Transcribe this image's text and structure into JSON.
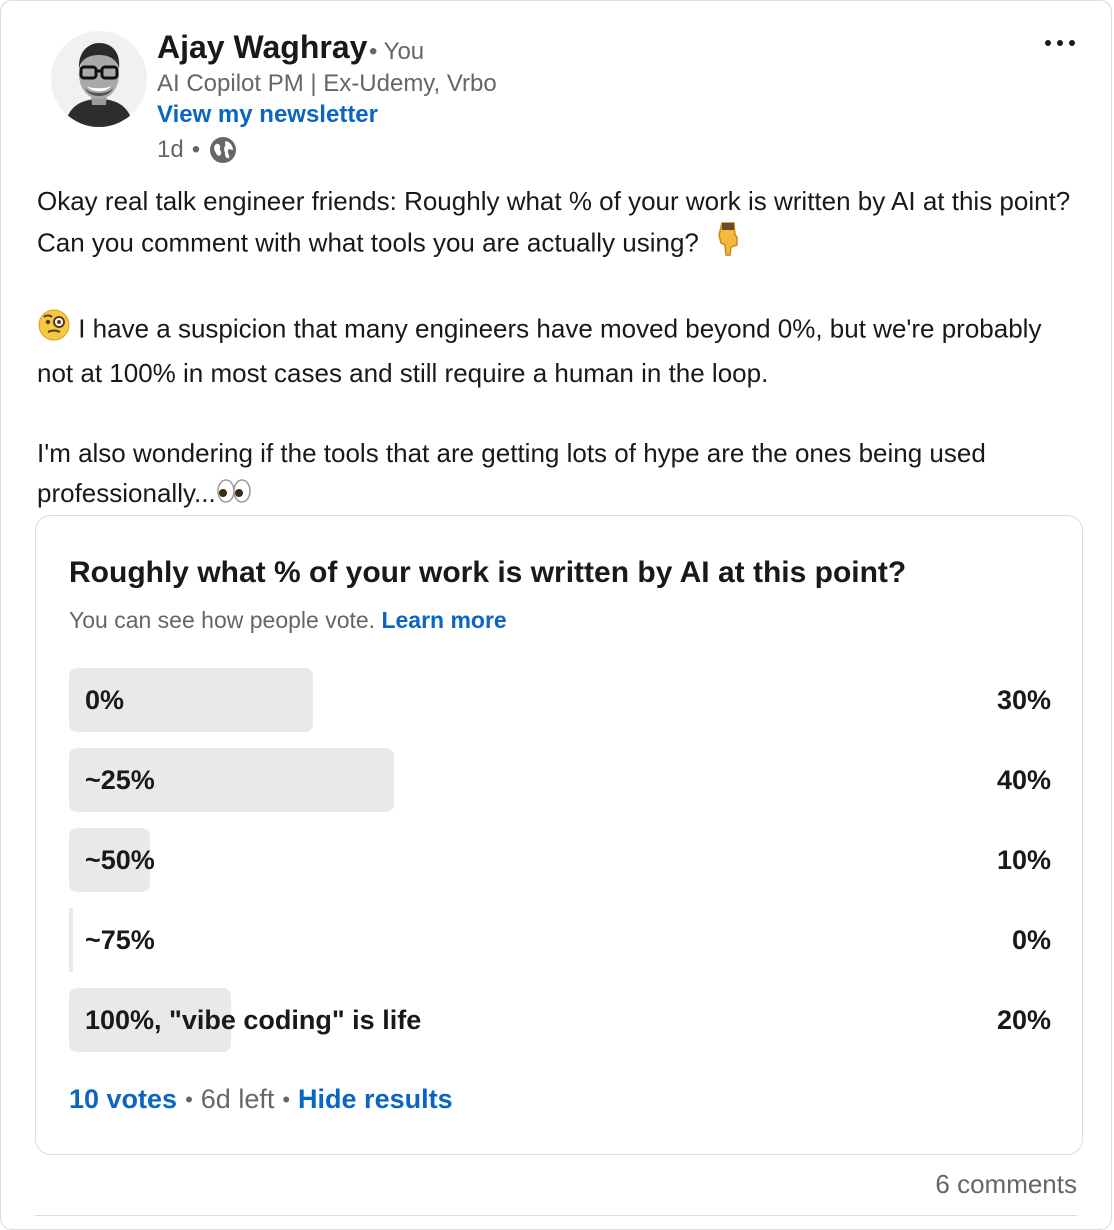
{
  "author": {
    "name": "Ajay Waghray",
    "relation": "• You",
    "headline": "AI Copilot PM | Ex-Udemy, Vrbo",
    "newsletter_link": "View my newsletter",
    "time": "1d",
    "dot": "•",
    "visibility_icon": "globe-icon"
  },
  "menu_icon": "more-horizontal-icon",
  "post": {
    "p1": "Okay real talk engineer friends: Roughly what % of your work is written by AI at this point? Can you comment with what tools you are actually using?",
    "p1_emoji": "backhand-index-pointing-down-emoji",
    "p2_emoji": "face-with-monocle-emoji",
    "p2": "I have a suspicion that many engineers have moved beyond 0%, but we're probably not at 100% in most cases and still require a human in the loop.",
    "p3": "I'm also wondering if the tools that are getting lots of hype are the ones being used professionally...",
    "p3_emoji": "eyes-emoji"
  },
  "poll": {
    "question": "Roughly what % of your work is written by AI at this point?",
    "visibility_note": "You can see how people vote.",
    "learn_more": "Learn more",
    "options": [
      {
        "label": "0%",
        "percent_text": "30%",
        "percent": 30
      },
      {
        "label": "~25%",
        "percent_text": "40%",
        "percent": 40
      },
      {
        "label": "~50%",
        "percent_text": "10%",
        "percent": 10
      },
      {
        "label": "~75%",
        "percent_text": "0%",
        "percent": 0
      },
      {
        "label": "100%, \"vibe coding\" is life",
        "percent_text": "20%",
        "percent": 20
      }
    ],
    "votes": "10 votes",
    "time_left": "6d left",
    "hide_results": "Hide results",
    "separator": "•",
    "bar_color": "#e9e9e9",
    "link_color": "#0a66c2"
  },
  "comments": "6 comments"
}
